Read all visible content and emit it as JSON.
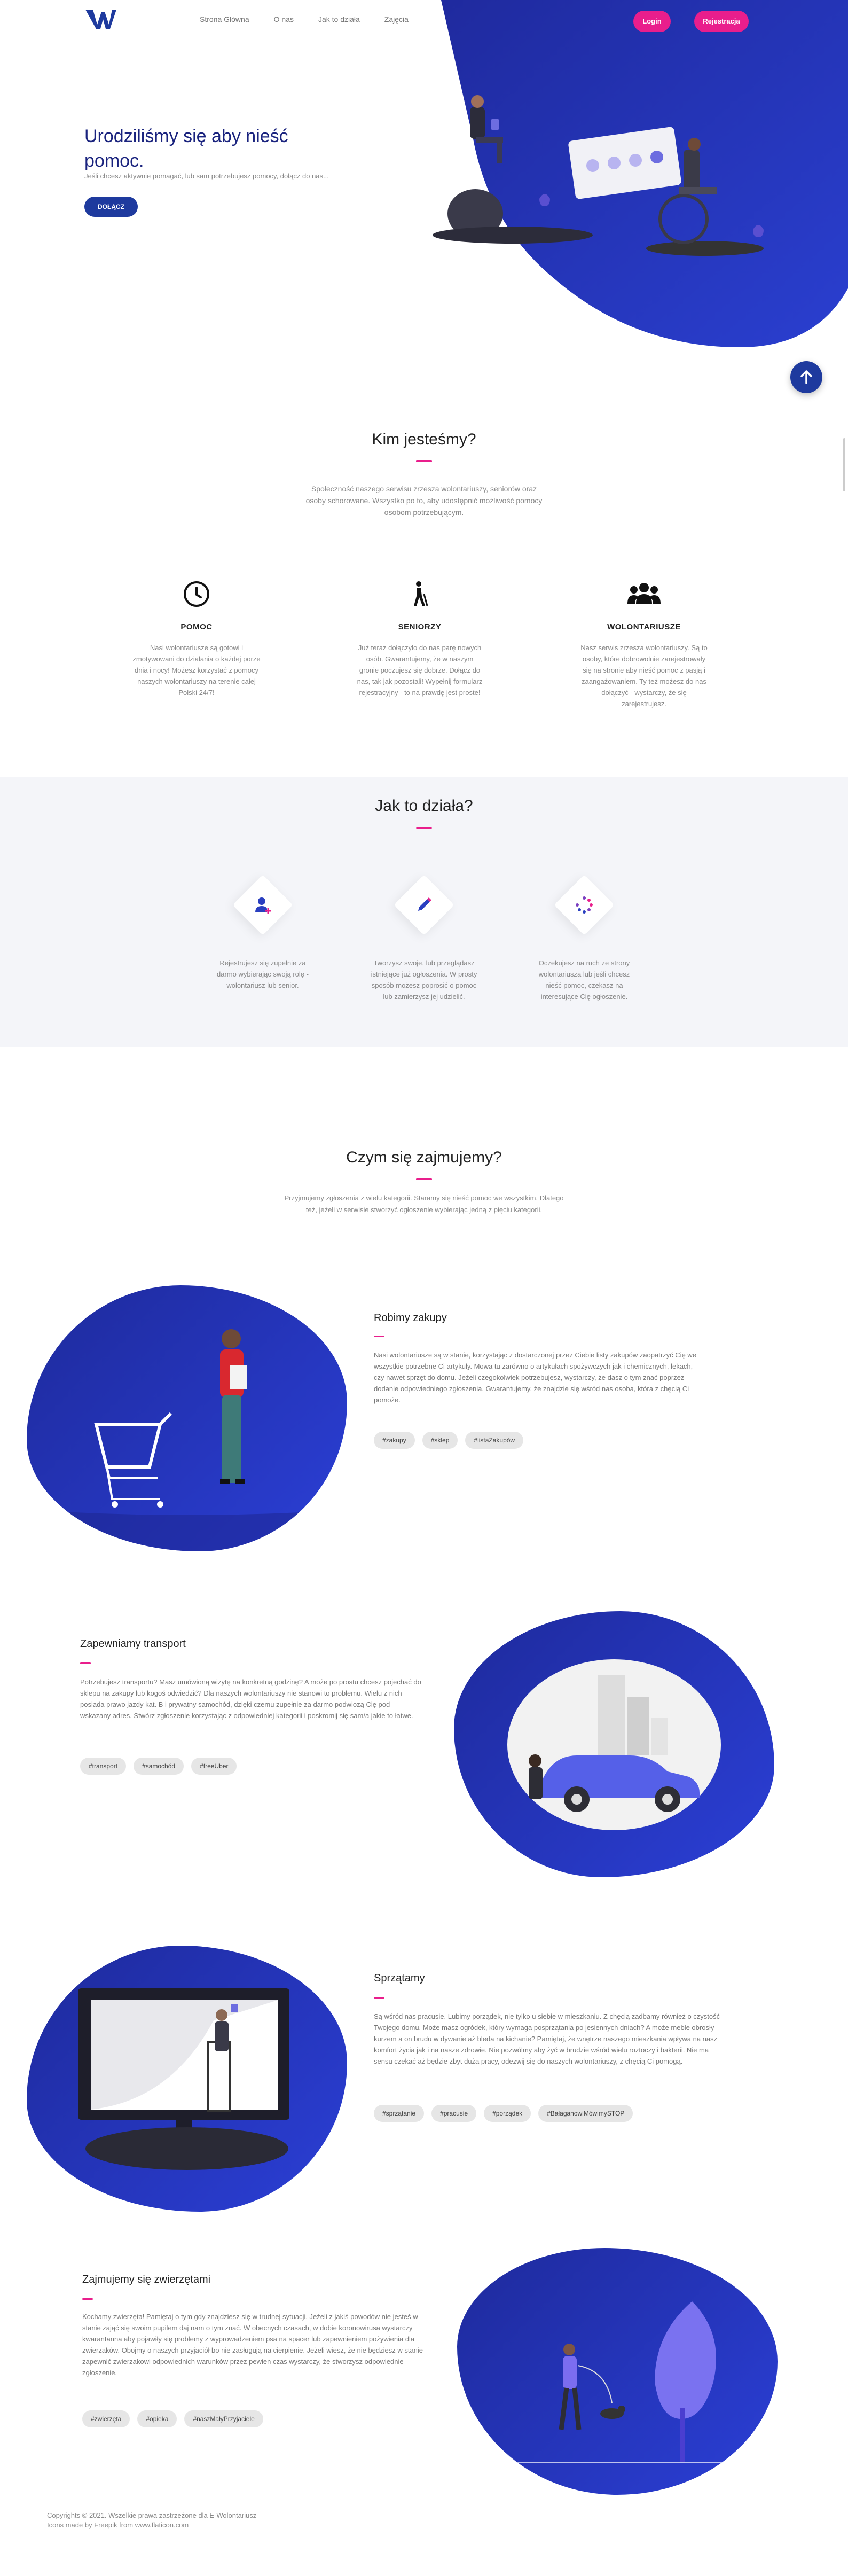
{
  "nav": {
    "items": [
      "Strona Główna",
      "O nas",
      "Jak to działa",
      "Zajęcia"
    ],
    "login": "Login",
    "register": "Rejestracja"
  },
  "hero": {
    "title": "Urodziliśmy się aby nieść pomoc.",
    "text": "Jeśli chcesz aktywnie pomagać, lub sam potrzebujesz pomocy, dołącz do nas...",
    "button": "DOŁĄCZ"
  },
  "about": {
    "title": "Kim jesteśmy?",
    "text": "Społeczność naszego serwisu zrzesza wolontariuszy, seniorów oraz osoby schorowane. Wszystko po to, aby udostępnić możliwość pomocy osobom potrzebującym.",
    "features": [
      {
        "icon": "clock-icon",
        "title": "POMOC",
        "desc": "Nasi wolontariusze są gotowi i zmotywowani do działania o każdej porze dnia i nocy! Możesz korzystać z pomocy naszych wolontariuszy na terenie całej Polski 24/7!"
      },
      {
        "icon": "senior-icon",
        "title": "SENIORZY",
        "desc": "Już teraz dołączyło do nas parę nowych osób. Gwarantujemy, że w naszym gronie poczujesz się dobrze. Dołącz do nas, tak jak pozostali! Wypełnij formularz rejestracyjny - to na prawdę jest proste!"
      },
      {
        "icon": "users-icon",
        "title": "WOLONTARIUSZE",
        "desc": "Nasz serwis zrzesza wolontariuszy. Są to osoby, które dobrowolnie zarejestrowały się na stronie aby nieść pomoc z pasją i zaangażowaniem. Ty też możesz do nas dołączyć - wystarczy, że się zarejestrujesz."
      }
    ]
  },
  "how": {
    "title": "Jak to działa?",
    "steps": [
      {
        "icon": "user-icon",
        "desc": "Rejestrujesz się zupełnie za darmo wybierając swoją rolę - wolontariusz lub senior."
      },
      {
        "icon": "pencil-icon",
        "desc": "Tworzysz swoje, lub przeglądasz istniejące już ogłoszenia. W prosty sposób możesz poprosić o pomoc lub zamierzysz jej udzielić."
      },
      {
        "icon": "spinner-icon",
        "desc": "Oczekujesz na ruch ze strony wolontariusza lub jeśli chcesz nieść pomoc, czekasz na interesujące Cię ogłoszenie."
      }
    ]
  },
  "what": {
    "title": "Czym się zajmujemy?",
    "text": "Przyjmujemy zgłoszenia z wielu kategorii. Staramy się nieść pomoc we wszystkim. Dlatego też, jeżeli w serwisie stworzyć ogłoszenie wybierając jedną z pięciu kategorii.",
    "cards": [
      {
        "title": "Robimy zakupy",
        "text": "Nasi wolontariusze są w stanie, korzystając z dostarczonej przez Ciebie listy zakupów zaopatrzyć Cię we wszystkie potrzebne Ci artykuły. Mowa tu zarówno o artykułach spożywczych jak i chemicznych, lekach, czy nawet sprzęt do domu. Jeżeli czegokolwiek potrzebujesz, wystarczy, że dasz o tym znać poprzez dodanie odpowiedniego zgłoszenia. Gwarantujemy, że znajdzie się wśród nas osoba, która z chęcią Ci pomoże.",
        "tags": [
          "#zakupy",
          "#sklep",
          "#listaZakupów"
        ]
      },
      {
        "title": "Zapewniamy transport",
        "text": "Potrzebujesz transportu? Masz umówioną wizytę na konkretną godzinę? A może po prostu chcesz pojechać do sklepu na zakupy lub kogoś odwiedzić? Dla naszych wolontariuszy nie stanowi to problemu. Wielu z nich posiada prawo jazdy kat. B i prywatny samochód, dzięki czemu zupełnie za darmo podwiozą Cię pod wskazany adres. Stwórz zgłoszenie korzystając z odpowiedniej kategorii i poskromij się sam/a jakie to łatwe.",
        "tags": [
          "#transport",
          "#samochód",
          "#freeUber"
        ]
      },
      {
        "title": "Sprzątamy",
        "text": "Są wśród nas pracusie. Lubimy porządek, nie tylko u siebie w mieszkaniu. Z chęcią zadbamy również o czystość Twojego domu. Może masz ogródek, który wymaga posprzątania po jesiennych dniach? A może meble obrosły kurzem a on brudu w dywanie aż bleda na kichanie? Pamiętaj, że wnętrze naszego mieszkania wpływa na nasz komfort życia jak i na nasze zdrowie. Nie pozwólmy aby żyć w brudzie wśród wielu roztoczy i bakterii. Nie ma sensu czekać aż będzie zbyt duża pracy, odezwij się do naszych wolontariuszy, z chęcią Ci pomogą.",
        "tags": [
          "#sprzątanie",
          "#pracusie",
          "#porządek",
          "#BałaganowiMówimySTOP"
        ]
      },
      {
        "title": "Zajmujemy się zwierzętami",
        "text": "Kochamy zwierzęta! Pamiętaj o tym gdy znajdziesz się w trudnej sytuacji. Jeżeli z jakiś powodów nie jesteś w stanie zająć się swoim pupilem daj nam o tym znać. W obecnych czasach, w dobie koronowirusa wystarczy kwarantanna aby pojawiły się problemy z wyprowadzeniem psa na spacer lub zapewnieniem pożywienia dla zwierzaków. Obojmy o naszych przyjaciół bo nie zasługują na cierpienie. Jeżeli wiesz, że nie będziesz w stanie zapewnić zwierzakowi odpowiednich warunków przez pewien czas wystarczy, że stworzysz odpowiednie zgłoszenie.",
        "tags": [
          "#zwierzęta",
          "#opieka",
          "#naszMałyPrzyjaciele"
        ]
      }
    ]
  },
  "footer": {
    "copyright": "Copyrights © 2021. Wszelkie prawa zastrzeżone dla E-Wolontariusz",
    "credit": "Icons made by Freepik from www.flaticon.com"
  },
  "colors": {
    "primary": "#1e3a9e",
    "accent": "#e91e8c",
    "blob": "#2233b8"
  }
}
